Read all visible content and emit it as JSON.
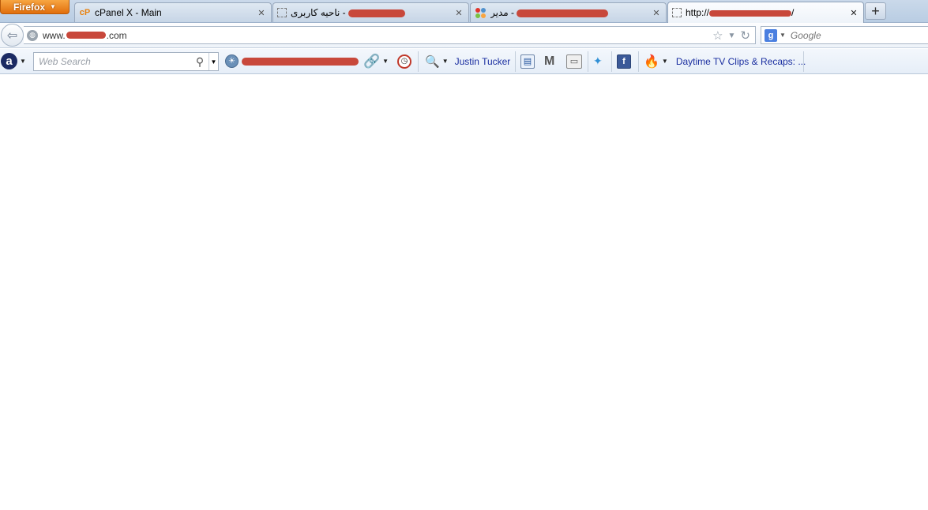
{
  "browser": {
    "app_button_label": "Firefox",
    "tabs": [
      {
        "favicon": "cpanel-icon",
        "favicon_text": "cP",
        "title": "cPanel X - Main",
        "selected": false
      },
      {
        "favicon": "blank-page-icon",
        "title": "ناحیه کاربری - ",
        "selected": false
      },
      {
        "favicon": "joomla-icon",
        "title": "مدیر - ",
        "selected": false
      },
      {
        "favicon": "blank-page-icon",
        "title": "http://",
        "title_suffix": "/",
        "selected": true
      }
    ],
    "new_tab_label": "+",
    "tab_close_glyph": "✕"
  },
  "navbar": {
    "back_glyph": "⇦",
    "url_prefix": "www.",
    "url_suffix": ".com",
    "search_engine_label": "g",
    "search_placeholder": "Google"
  },
  "toolbar": {
    "ask_logo_text": "a",
    "web_search_placeholder": "Web Search",
    "contact_link": "Justin Tucker",
    "daytime_link": "Daytime TV Clips & Recaps: ..."
  },
  "colors": {
    "firefox_orange": "#e8810f",
    "redaction": "#c8483b",
    "link_blue": "#1a2ea0",
    "tabstrip_blue": "#c2d3e7"
  }
}
